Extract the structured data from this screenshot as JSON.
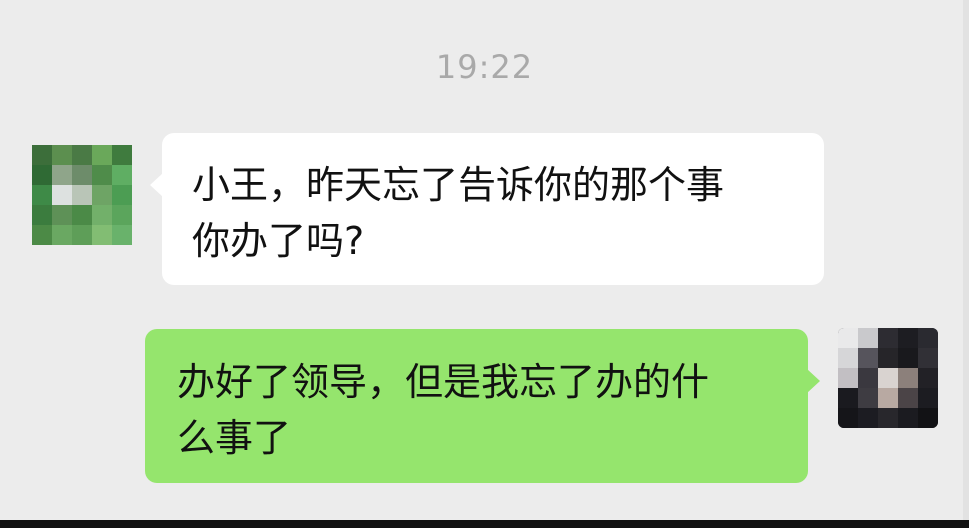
{
  "timestamp": "19:22",
  "messages": [
    {
      "side": "left",
      "lines": [
        "小王，昨天忘了告诉你的那个事",
        "你办了吗?"
      ]
    },
    {
      "side": "right",
      "lines": [
        "办好了领导，但是我忘了办的什",
        "么事了"
      ]
    }
  ],
  "colors": {
    "background": "#ececec",
    "incoming_bubble": "#ffffff",
    "outgoing_bubble": "#95e56d",
    "timestamp_text": "#a9a9a9"
  },
  "icons": {
    "left_avatar": "pixelated-avatar-icon",
    "right_avatar": "pixelated-avatar-icon"
  }
}
